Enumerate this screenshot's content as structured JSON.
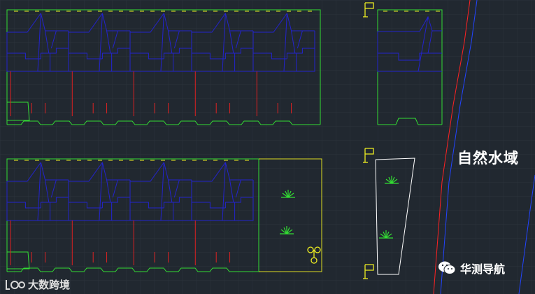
{
  "canvas": {
    "background": "#212830",
    "grid_color": "#2b323b",
    "colors": {
      "boundary": "#33dd33",
      "roof": "#2323cc",
      "fire_line": "#dd2222",
      "plot": "#dddd22",
      "yellow_symbol": "#eeee22",
      "white_outline": "#ffffff",
      "water_blue": "#2244ff",
      "water_red": "#ff2222"
    }
  },
  "labels": {
    "water_area": "自然水域"
  },
  "watermarks": {
    "right_text": "华测导航",
    "right_icon": "wechat-icon",
    "left_text": "大数跨境",
    "left_icon": "brand-logo-icon"
  }
}
